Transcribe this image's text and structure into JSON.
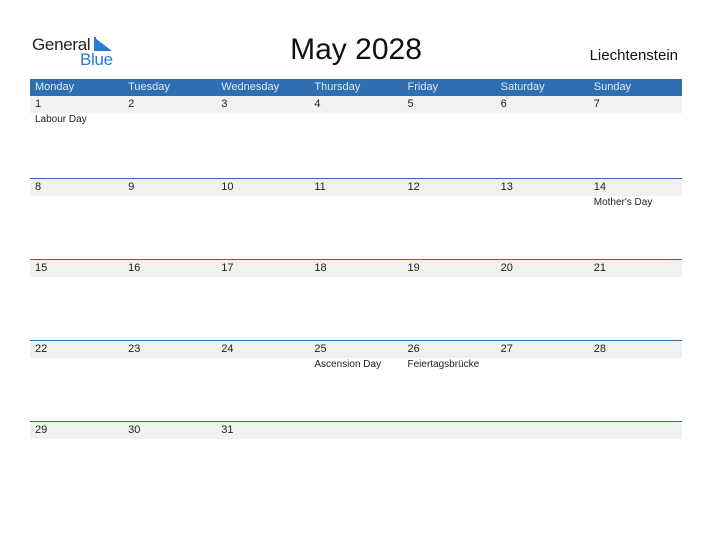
{
  "logo": {
    "general": "General",
    "blue": "Blue"
  },
  "title": "May 2028",
  "country": "Liechtenstein",
  "colors": {
    "header_bg": "#2e6eb1",
    "accent": "#2a7ad6",
    "date_band": "#f1f1f1"
  },
  "weekdays": [
    "Monday",
    "Tuesday",
    "Wednesday",
    "Thursday",
    "Friday",
    "Saturday",
    "Sunday"
  ],
  "weeks": [
    {
      "dates": [
        "1",
        "2",
        "3",
        "4",
        "5",
        "6",
        "7"
      ],
      "events": [
        "Labour Day",
        "",
        "",
        "",
        "",
        "",
        ""
      ]
    },
    {
      "dates": [
        "8",
        "9",
        "10",
        "11",
        "12",
        "13",
        "14"
      ],
      "events": [
        "",
        "",
        "",
        "",
        "",
        "",
        "Mother's Day"
      ]
    },
    {
      "dates": [
        "15",
        "16",
        "17",
        "18",
        "19",
        "20",
        "21"
      ],
      "events": [
        "",
        "",
        "",
        "",
        "",
        "",
        ""
      ]
    },
    {
      "dates": [
        "22",
        "23",
        "24",
        "25",
        "26",
        "27",
        "28"
      ],
      "events": [
        "",
        "",
        "",
        "Ascension Day",
        "Feiertagsbrücke",
        "",
        ""
      ]
    },
    {
      "dates": [
        "29",
        "30",
        "31",
        "",
        "",
        "",
        ""
      ],
      "events": [
        "",
        "",
        "",
        "",
        "",
        "",
        ""
      ]
    }
  ]
}
